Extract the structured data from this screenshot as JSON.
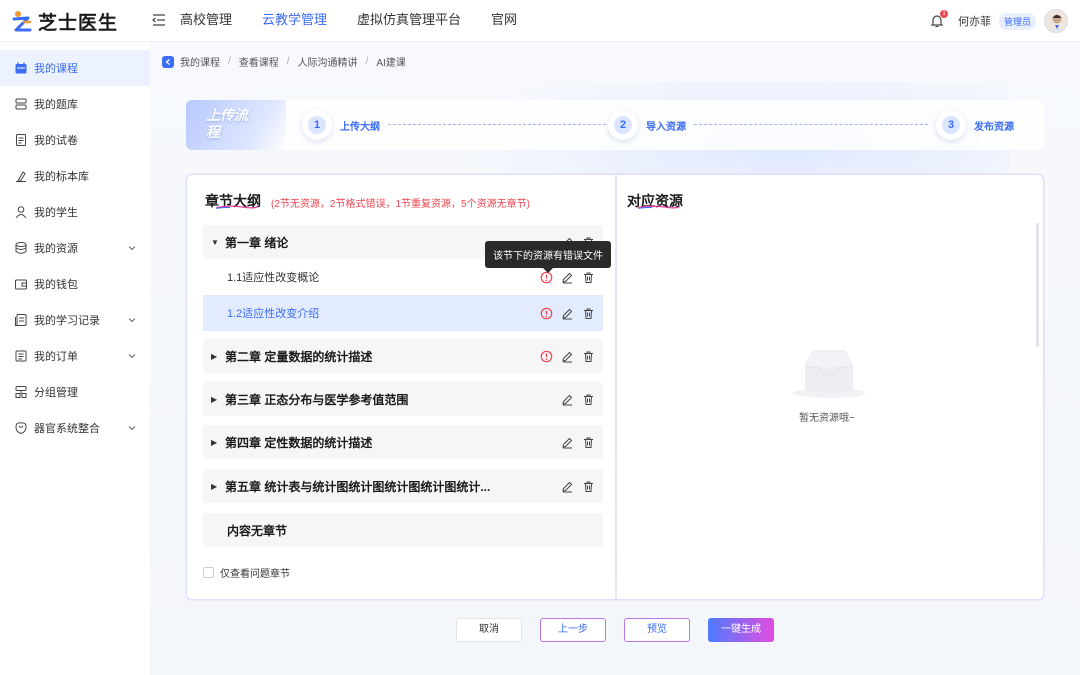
{
  "app": {
    "brand": "芝士医生"
  },
  "topnav": [
    {
      "label": "高校管理",
      "active": false
    },
    {
      "label": "云教学管理",
      "active": true
    },
    {
      "label": "虚拟仿真管理平台",
      "active": false
    },
    {
      "label": "官网",
      "active": false
    }
  ],
  "user": {
    "name": "何亦菲",
    "role": "管理员",
    "notifications": "1"
  },
  "sidebar": {
    "items": [
      {
        "label": "我的课程",
        "icon": "calendar-icon",
        "active": true,
        "expandable": false
      },
      {
        "label": "我的题库",
        "icon": "database-icon",
        "active": false,
        "expandable": false
      },
      {
        "label": "我的试卷",
        "icon": "paper-icon",
        "active": false,
        "expandable": false
      },
      {
        "label": "我的标本库",
        "icon": "specimen-icon",
        "active": false,
        "expandable": false
      },
      {
        "label": "我的学生",
        "icon": "user-icon",
        "active": false,
        "expandable": false
      },
      {
        "label": "我的资源",
        "icon": "resource-icon",
        "active": false,
        "expandable": true
      },
      {
        "label": "我的钱包",
        "icon": "wallet-icon",
        "active": false,
        "expandable": false
      },
      {
        "label": "我的学习记录",
        "icon": "record-icon",
        "active": false,
        "expandable": true
      },
      {
        "label": "我的订单",
        "icon": "order-icon",
        "active": false,
        "expandable": true
      },
      {
        "label": "分组管理",
        "icon": "group-icon",
        "active": false,
        "expandable": false
      },
      {
        "label": "器官系统整合",
        "icon": "organ-icon",
        "active": false,
        "expandable": true
      }
    ]
  },
  "breadcrumb": [
    "我的课程",
    "查看课程",
    "人际沟通精讲",
    "AI建课"
  ],
  "steps": {
    "tag": "上传流程",
    "items": [
      {
        "num": "1",
        "label": "上传大纲"
      },
      {
        "num": "2",
        "label": "导入资源"
      },
      {
        "num": "3",
        "label": "发布资源"
      }
    ]
  },
  "outline": {
    "title": "章节大纲",
    "summary": "(2节无资源，2节格式错误，1节重复资源，5个资源无章节)",
    "tooltip": "该节下的资源有错误文件",
    "chapters": [
      {
        "label": "第一章 绪论",
        "expanded": true,
        "error": false
      },
      {
        "label": "第二章 定量数据的统计描述",
        "expanded": false,
        "error": true
      },
      {
        "label": "第三章 正态分布与医学参考值范围",
        "expanded": false,
        "error": false
      },
      {
        "label": "第四章 定性数据的统计描述",
        "expanded": false,
        "error": false
      },
      {
        "label": "第五章 统计表与统计图统计图统计图统计图统计...",
        "expanded": false,
        "error": false
      }
    ],
    "sections": [
      {
        "label": "1.1适应性改变概论",
        "error": true,
        "selected": false
      },
      {
        "label": "1.2适应性改变介绍",
        "error": true,
        "selected": true
      }
    ],
    "no_chapter": "内容无章节",
    "filter_label": "仅查看问题章节"
  },
  "resources": {
    "title": "对应资源",
    "empty_text": "暂无资源哦~"
  },
  "buttons": {
    "cancel": "取消",
    "prev": "上一步",
    "preview": "预览",
    "generate": "一键生成"
  },
  "colors": {
    "accent": "#3b6cf5",
    "error": "#f0454f",
    "selected_bg": "#e3ebff"
  }
}
